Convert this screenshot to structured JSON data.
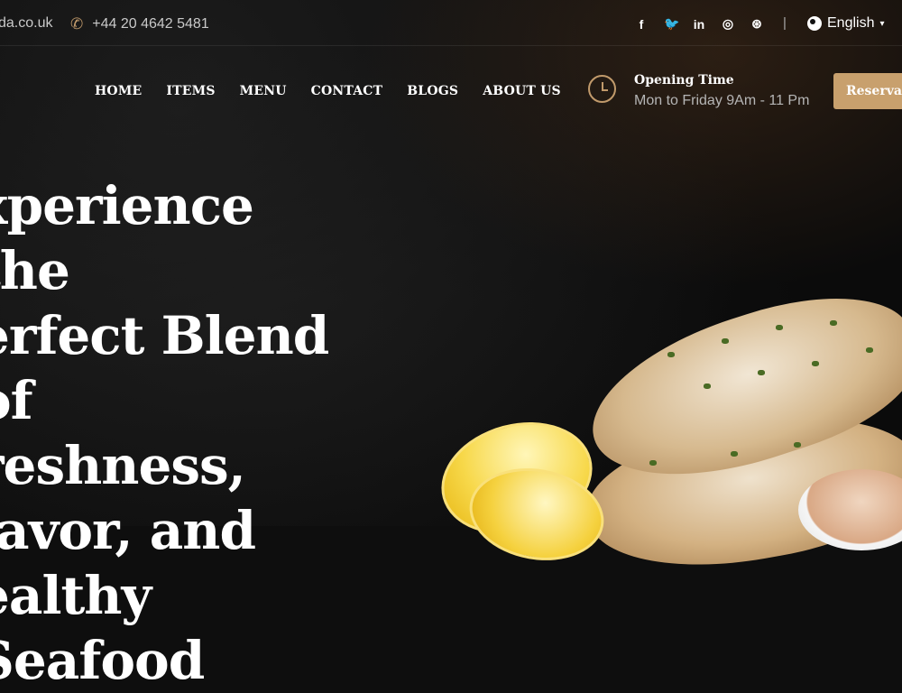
{
  "topbar": {
    "email": "da.co.uk",
    "phone": "+44 20 4642 5481",
    "socials": [
      "facebook-icon",
      "twitter-icon",
      "linkedin-icon",
      "instagram-icon",
      "dribbble-icon"
    ],
    "social_glyphs": {
      "facebook": "f",
      "twitter": "🐦",
      "linkedin": "in",
      "instagram": "◎",
      "dribbble": "⊛"
    },
    "divider": "|",
    "language": "English"
  },
  "nav": {
    "items": [
      "HOME",
      "ITEMS",
      "MENU",
      "CONTACT",
      "BLOGS",
      "ABOUT US"
    ]
  },
  "opening": {
    "title": "Opening Time",
    "hours": "Mon to Friday 9Am - 11 Pm"
  },
  "reserve_button": "Reservation",
  "hero": {
    "title": "xperience the\nerfect Blend of\nreshness,\nlavor, and\nealthy Seafood"
  },
  "colors": {
    "accent": "#c8a06d",
    "background": "#0e0e0e"
  }
}
